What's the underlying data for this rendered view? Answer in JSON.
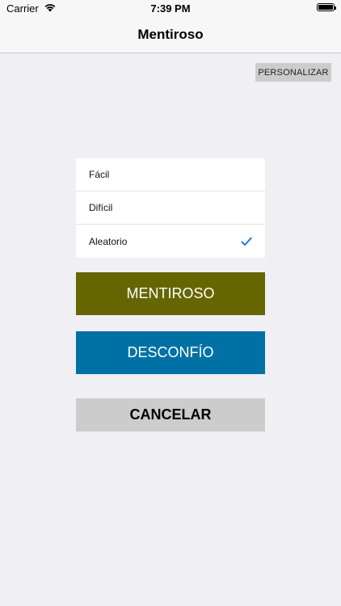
{
  "status_bar": {
    "carrier": "Carrier",
    "time": "7:39 PM"
  },
  "nav": {
    "title": "Mentiroso"
  },
  "customize_button": {
    "label": "PERSONALIZAR"
  },
  "options": [
    {
      "label": "Fácil",
      "selected": false
    },
    {
      "label": "Difícil",
      "selected": false
    },
    {
      "label": "Aleatorio",
      "selected": true
    }
  ],
  "actions": {
    "liar_label": "MENTIROSO",
    "distrust_label": "DESCONFÍO",
    "cancel_label": "CANCELAR"
  },
  "colors": {
    "liar": "#666600",
    "distrust": "#0071a4",
    "cancel": "#cccccc",
    "check": "#1a7be6"
  },
  "icons": {
    "wifi": "wifi-icon",
    "battery": "battery-icon",
    "selected_check": "checkmark-icon"
  }
}
